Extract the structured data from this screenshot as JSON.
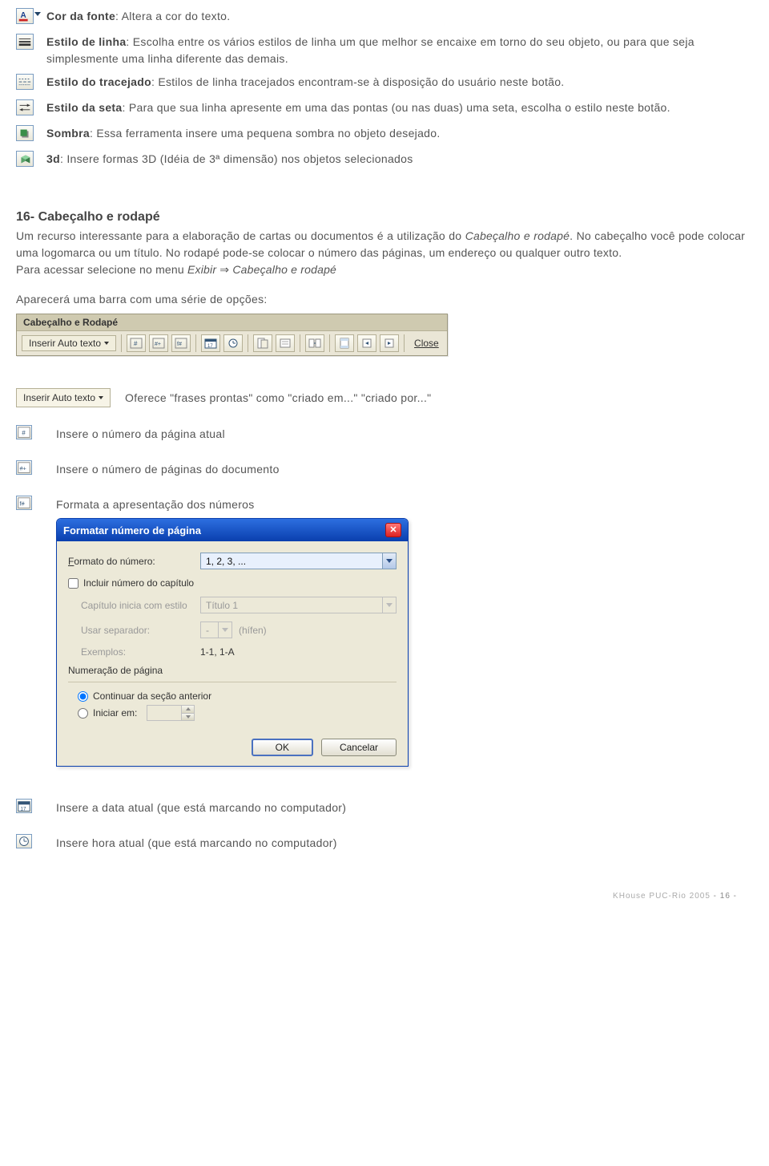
{
  "definitions": [
    {
      "label": "Cor da fonte",
      "text": ": Altera a cor do texto."
    },
    {
      "label": "Estilo de linha",
      "text": ": Escolha entre os vários estilos de linha um que melhor se encaixe em torno do seu objeto, ou para que seja simplesmente uma linha diferente das demais."
    },
    {
      "label": "Estilo do  tracejado",
      "text": ": Estilos de linha tracejados encontram-se à disposição do usuário neste botão."
    },
    {
      "label": "Estilo da  seta",
      "text": ": Para que sua linha apresente em uma das pontas (ou nas duas) uma seta, escolha o estilo neste botão."
    },
    {
      "label": "Sombra",
      "text": ": Essa ferramenta insere uma pequena sombra no objeto desejado."
    },
    {
      "label": "3d",
      "text": ": Insere formas 3D (Idéia de 3ª dimensão) nos objetos selecionados"
    }
  ],
  "section": {
    "heading": "16-  Cabeçalho e rodapé",
    "p1a": "Um recurso interessante para a elaboração de cartas ou documentos é a utilização do ",
    "p1i": "Cabeçalho e rodapé",
    "p1b": ". No cabeçalho você pode colocar uma logomarca ou um título. No rodapé pode-se colocar o número das páginas, um endereço  ou qualquer outro texto.",
    "p2a": "Para acessar selecione no menu ",
    "p2i1": "Exibir",
    "p2arrow": " ⇒ ",
    "p2i2": "Cabeçalho e rodapé",
    "appear": "Aparecerá uma barra com uma série de opções:"
  },
  "hf_toolbar": {
    "title": "Cabeçalho e Rodapé",
    "autotext": "Inserir Auto texto",
    "close": "Close"
  },
  "autotext_desc": "Oferece \"frases prontas\" como \"criado em...\" \"criado por...\"",
  "icon_descs": {
    "page_num": "Insere o número da página atual",
    "page_count": "Insere o número de páginas do documento",
    "format_num": "Formata a apresentação dos números",
    "date": "Insere a data atual (que está marcando no computador)",
    "time": "Insere hora atual (que está marcando no computador)"
  },
  "dialog": {
    "title": "Formatar número de página",
    "format_label": "Formato do número:",
    "format_value": "1, 2, 3, ...",
    "include_chapter": "Incluir número do capítulo",
    "chapter_starts": "Capítulo inicia com estilo",
    "chapter_value": "Título 1",
    "separator_label": "Usar separador:",
    "separator_value": "-",
    "separator_hint": "(hífen)",
    "examples_label": "Exemplos:",
    "examples_value": "1-1, 1-A",
    "group_label": "Numeração de página",
    "radio_continue": "Continuar da seção anterior",
    "radio_start": "Iniciar em:",
    "ok": "OK",
    "cancel": "Cancelar"
  },
  "footer": {
    "text": "KHouse PUC-Rio 2005",
    "page": "- 16 -"
  }
}
